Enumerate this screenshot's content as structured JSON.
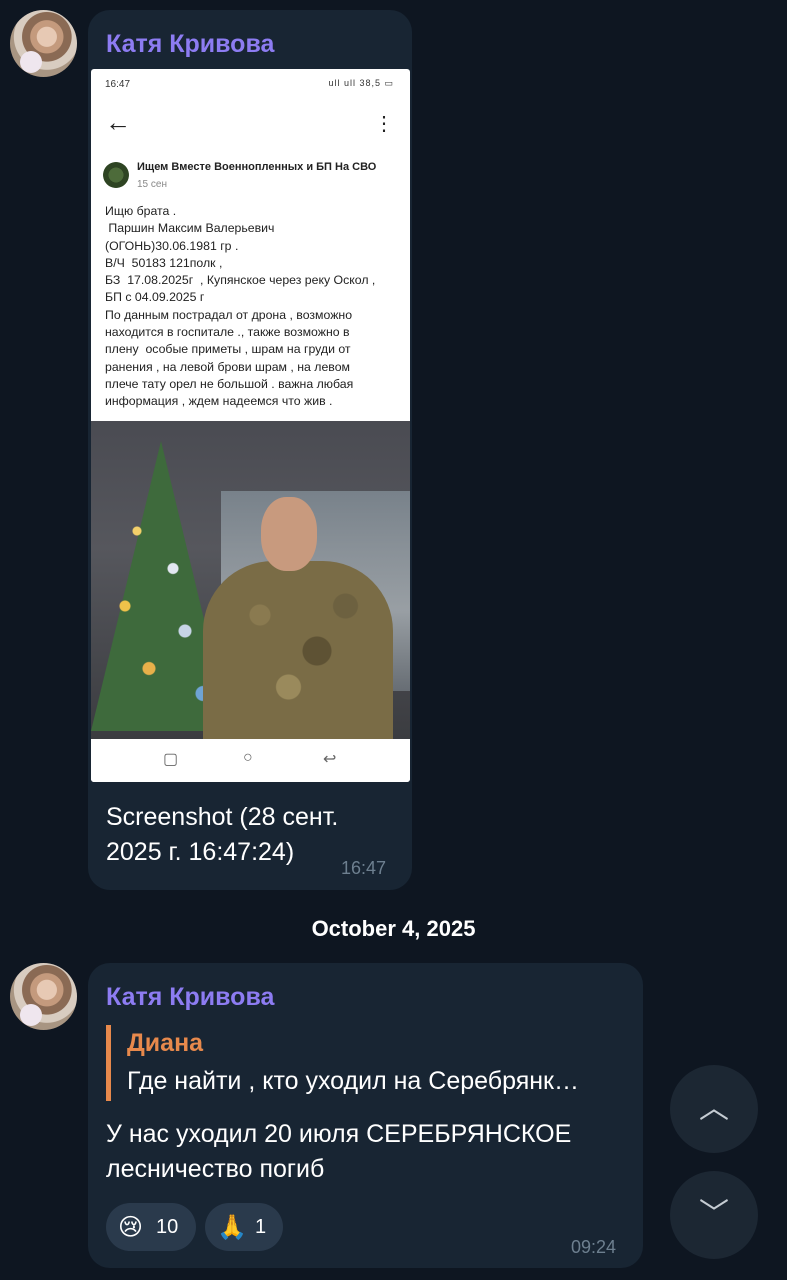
{
  "messages": [
    {
      "sender": "Катя Кривова",
      "screenshot": {
        "status_time": "16:47",
        "status_icons": "ull ull 38,5 ▭",
        "back_icon": "arrow-left-icon",
        "channel_name": "Ищем Вместе Военнопленных и БП На СВО",
        "channel_date": "15 сен",
        "post_lines": [
          "Ищю брата .",
          " Паршин Максим Валерьевич",
          "(ОГОНЬ)30.06.1981 гр .",
          "В/Ч  50183 121полк ,",
          "БЗ  17.08.2025г  , Купянское через реку Оскол ,",
          "БП с 04.09.2025 г",
          "По данным пострадал от дрона , возможно",
          "находится в госпитале ., также возможно в",
          "плену  особые приметы , шрам на груди от",
          "ранения , на левой брови шрам , на левом",
          "плече тату орел не большой . важна любая",
          "информация , ждем надеемся что жив ."
        ]
      },
      "caption_line1": "Screenshot (28 сент.",
      "caption_line2": "2025 г. 16:47:24)",
      "time": "16:47"
    },
    {
      "sender": "Катя Кривова",
      "reply_to_name": "Диана",
      "reply_to_text": "Где найти , кто уходил на Серебрянк…",
      "text_line1": "У нас уходил 20 июля СЕРЕБРЯНСКОЕ",
      "text_line2": "лесничество погиб",
      "reactions": [
        {
          "emoji": "😢",
          "count": "10"
        },
        {
          "emoji": "🙏",
          "count": "1"
        }
      ],
      "time": "09:24"
    }
  ],
  "date_separator": "October 4, 2025",
  "scroll_buttons": {
    "up_icon": "chevron-up-icon",
    "down_icon": "chevron-down-icon"
  },
  "colors": {
    "background": "#0e1621",
    "bubble": "#182533",
    "sender": "#8d7cf2",
    "reply_accent": "#e7894c",
    "time": "#6d7f8f"
  }
}
